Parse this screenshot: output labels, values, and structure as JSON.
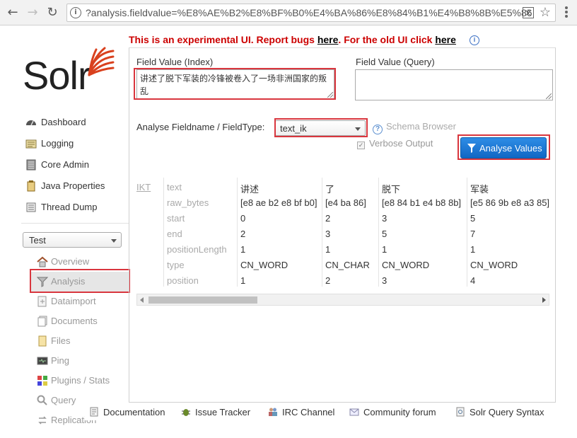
{
  "browser": {
    "url": "?analysis.fieldvalue=%E8%AE%B2%E8%BF%B0%E4%BA%86%E8%84%B1%E4%B8%8B%E5%86",
    "back_glyph": "←",
    "forward_glyph": "→",
    "reload_glyph": "↻",
    "star_glyph": "☆",
    "translate_glyph": "文",
    "info_glyph": "i"
  },
  "warning": {
    "prefix": "This is an experimental UI. Report bugs ",
    "bugs_link": "here",
    "middle": ". For the old UI click ",
    "old_link": "here"
  },
  "logo": {
    "text": "Solr"
  },
  "sidebar": {
    "items": [
      {
        "label": "Dashboard",
        "icon": "dashboard-icon"
      },
      {
        "label": "Logging",
        "icon": "logging-icon"
      },
      {
        "label": "Core Admin",
        "icon": "core-admin-icon"
      },
      {
        "label": "Java Properties",
        "icon": "java-properties-icon"
      },
      {
        "label": "Thread Dump",
        "icon": "thread-dump-icon"
      }
    ],
    "core_selector": {
      "selected": "Test"
    },
    "core_items": [
      {
        "label": "Overview",
        "icon": "home-icon"
      },
      {
        "label": "Analysis",
        "icon": "funnel-icon"
      },
      {
        "label": "Dataimport",
        "icon": "dataimport-icon"
      },
      {
        "label": "Documents",
        "icon": "documents-icon"
      },
      {
        "label": "Files",
        "icon": "files-icon"
      },
      {
        "label": "Ping",
        "icon": "ping-icon"
      },
      {
        "label": "Plugins / Stats",
        "icon": "plugins-icon"
      },
      {
        "label": "Query",
        "icon": "query-icon"
      },
      {
        "label": "Replication",
        "icon": "replication-icon"
      }
    ]
  },
  "analysis": {
    "index_label": "Field Value (Index)",
    "index_value": "讲述了脱下军装的冷锋被卷入了一场非洲国家的叛乱",
    "query_label": "Field Value (Query)",
    "query_value": "",
    "fieldtype_label": "Analyse Fieldname / FieldType:",
    "fieldtype_value": "text_ik",
    "schema_browser": "Schema Browser",
    "verbose_label": "Verbose Output",
    "verbose_checked": true,
    "analyse_button": "Analyse Values",
    "tokenizer": "IKT",
    "attributes": [
      "text",
      "raw_bytes",
      "start",
      "end",
      "positionLength",
      "type",
      "position"
    ],
    "tokens": [
      {
        "text": "讲述",
        "raw_bytes": "[e8 ae b2 e8 bf b0]",
        "start": "0",
        "end": "2",
        "positionLength": "1",
        "type": "CN_WORD",
        "position": "1"
      },
      {
        "text": "了",
        "raw_bytes": "[e4 ba 86]",
        "start": "2",
        "end": "3",
        "positionLength": "1",
        "type": "CN_CHAR",
        "position": "2"
      },
      {
        "text": "脱下",
        "raw_bytes": "[e8 84 b1 e4 b8 8b]",
        "start": "3",
        "end": "5",
        "positionLength": "1",
        "type": "CN_WORD",
        "position": "3"
      },
      {
        "text": "军装",
        "raw_bytes": "[e5 86 9b e8 a3 85]",
        "start": "5",
        "end": "7",
        "positionLength": "1",
        "type": "CN_WORD",
        "position": "4"
      }
    ]
  },
  "footer": {
    "items": [
      {
        "label": "Documentation",
        "icon": "documentation-icon"
      },
      {
        "label": "Issue Tracker",
        "icon": "bug-icon"
      },
      {
        "label": "IRC Channel",
        "icon": "irc-icon"
      },
      {
        "label": "Community forum",
        "icon": "mail-icon"
      },
      {
        "label": "Solr Query Syntax",
        "icon": "query-syntax-icon"
      }
    ]
  },
  "colors": {
    "warning_red": "#cc0000",
    "highlight_red": "#d9363e",
    "button_blue": "#1a78d6",
    "solr_orange": "#d9411e"
  }
}
